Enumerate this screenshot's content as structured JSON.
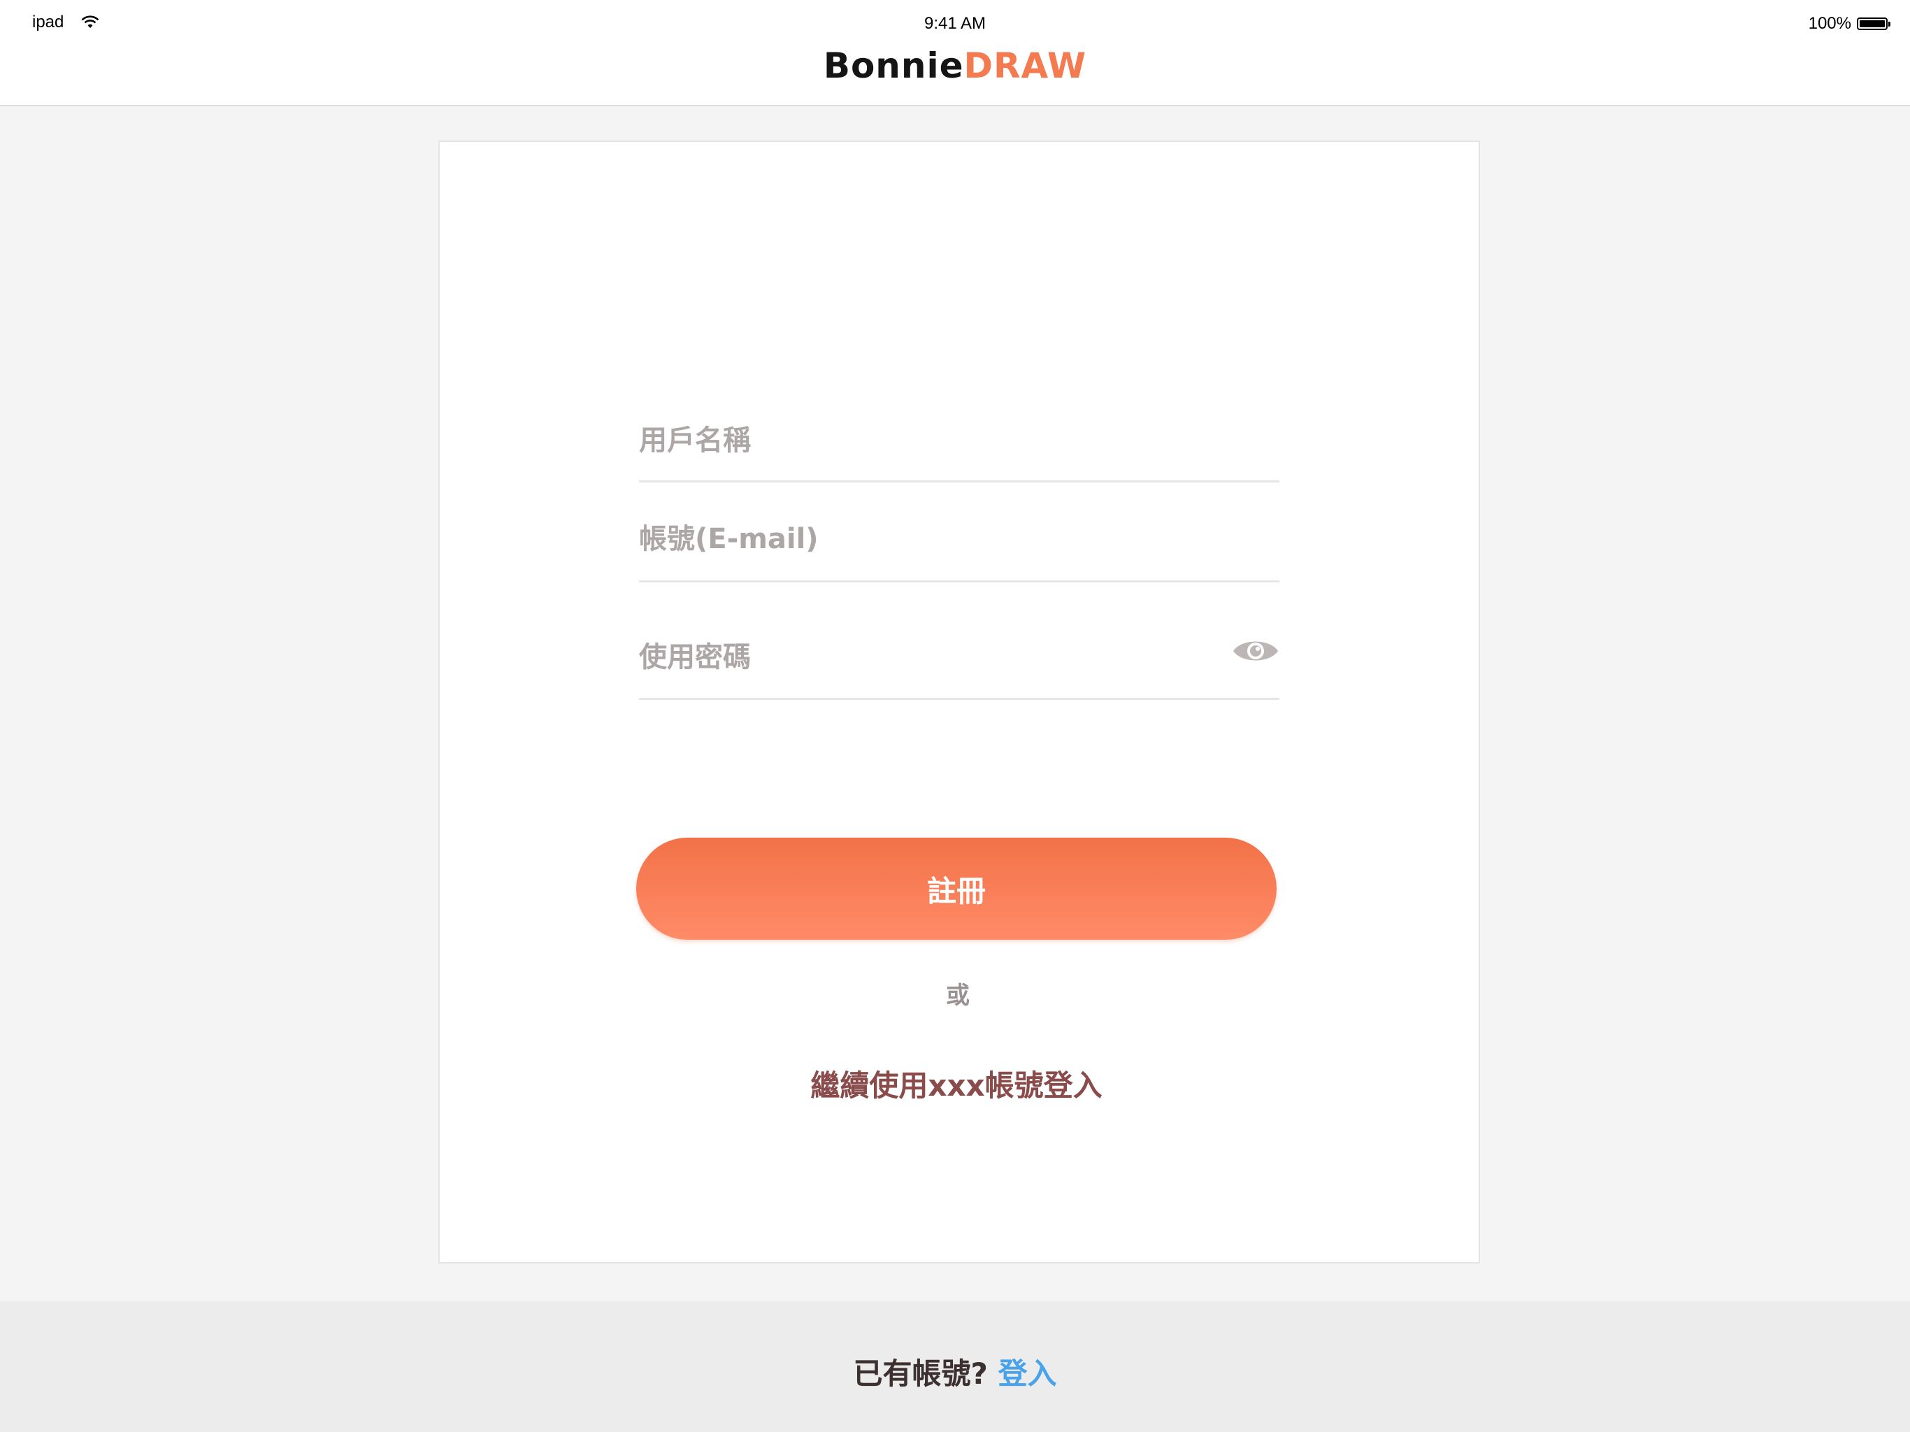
{
  "status_bar": {
    "device": "ipad",
    "time": "9:41 AM",
    "battery": "100%",
    "battery_level": 1.0
  },
  "header": {
    "logo_dark": "Bonnie",
    "logo_accent": "DRAW",
    "accent_color": "#f47a50"
  },
  "form": {
    "username_placeholder": "用戶名稱",
    "email_placeholder": "帳號(E-mail)",
    "password_placeholder": "使用密碼",
    "password_toggle_icon": "eye-icon",
    "register_label": "註冊",
    "or_label": "或",
    "sso_label": "繼續使用xxx帳號登入"
  },
  "footer": {
    "prompt": "已有帳號?",
    "login_label": "登入",
    "link_color": "#4aa3e8"
  }
}
